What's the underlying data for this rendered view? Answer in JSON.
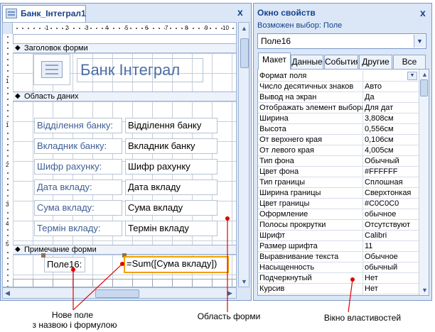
{
  "form_window": {
    "tab_title": "Банк_Інтеграл1",
    "close_glyph": "x",
    "ruler_left_numbers": [
      "1",
      "1",
      "2",
      "3",
      "4",
      "5"
    ],
    "sections": {
      "header": "Заголовок форми",
      "detail": "Область даних",
      "footer": "Примечание форми"
    },
    "form_title": "Банк Інтеграл",
    "fields": [
      {
        "label": "Відділення банку:",
        "value": "Відділення банку"
      },
      {
        "label": "Вкладник банку:",
        "value": "Вкладник банку"
      },
      {
        "label": "Шифр рахунку:",
        "value": "Шифр рахунку"
      },
      {
        "label": "Дата вкладу:",
        "value": "Дата вкладу"
      },
      {
        "label": "Сума вкладу:",
        "value": "Сума вкладу"
      },
      {
        "label": "Термін вкладу:",
        "value": "Термін вкладу"
      }
    ],
    "footer_label": "Поле16:",
    "footer_formula": "=Sum([Сума вкладу])"
  },
  "property_sheet": {
    "title": "Окно свойств",
    "close_glyph": "x",
    "selection_type": "Возможен выбор:  Поле",
    "selected_object": "Поле16",
    "tabs": [
      "Макет",
      "Данные",
      "События",
      "Другие",
      "Все"
    ],
    "active_tab": "Макет",
    "properties": [
      {
        "name": "Формат поля",
        "value": ""
      },
      {
        "name": "Число десятичных знаков",
        "value": "Авто"
      },
      {
        "name": "Вывод на экран",
        "value": "Да"
      },
      {
        "name": "Отображать элемент выбора",
        "value": "Для дат"
      },
      {
        "name": "Ширина",
        "value": "3,808см"
      },
      {
        "name": "Высота",
        "value": "0,556см"
      },
      {
        "name": "От верхнего края",
        "value": "0,106см"
      },
      {
        "name": "От левого края",
        "value": "4,005см"
      },
      {
        "name": "Тип фона",
        "value": "Обычный"
      },
      {
        "name": "Цвет фона",
        "value": "#FFFFFF"
      },
      {
        "name": "Тип границы",
        "value": "Сплошная"
      },
      {
        "name": "Ширина границы",
        "value": "Сверхтонкая"
      },
      {
        "name": "Цвет границы",
        "value": "#C0C0C0"
      },
      {
        "name": "Оформление",
        "value": "обычное"
      },
      {
        "name": "Полосы прокрутки",
        "value": "Отсутствуют"
      },
      {
        "name": "Шрифт",
        "value": "Calibri"
      },
      {
        "name": "Размер шрифта",
        "value": "11"
      },
      {
        "name": "Выравнивание текста",
        "value": "Обычное"
      },
      {
        "name": "Насыщенность",
        "value": "обычный"
      },
      {
        "name": "Подчеркнутый",
        "value": "Нет"
      },
      {
        "name": "Курсив",
        "value": "Нет"
      }
    ]
  },
  "annotations": {
    "new_field_line1": "Нове поле",
    "new_field_line2": "з назвою і формулою",
    "form_area": "Область форми",
    "properties_window": "Вікно властивостей"
  },
  "colors": {
    "accent": "#15428b",
    "label_text": "#3d5f95",
    "selection": "#f3a000",
    "callout": "#e00000"
  }
}
